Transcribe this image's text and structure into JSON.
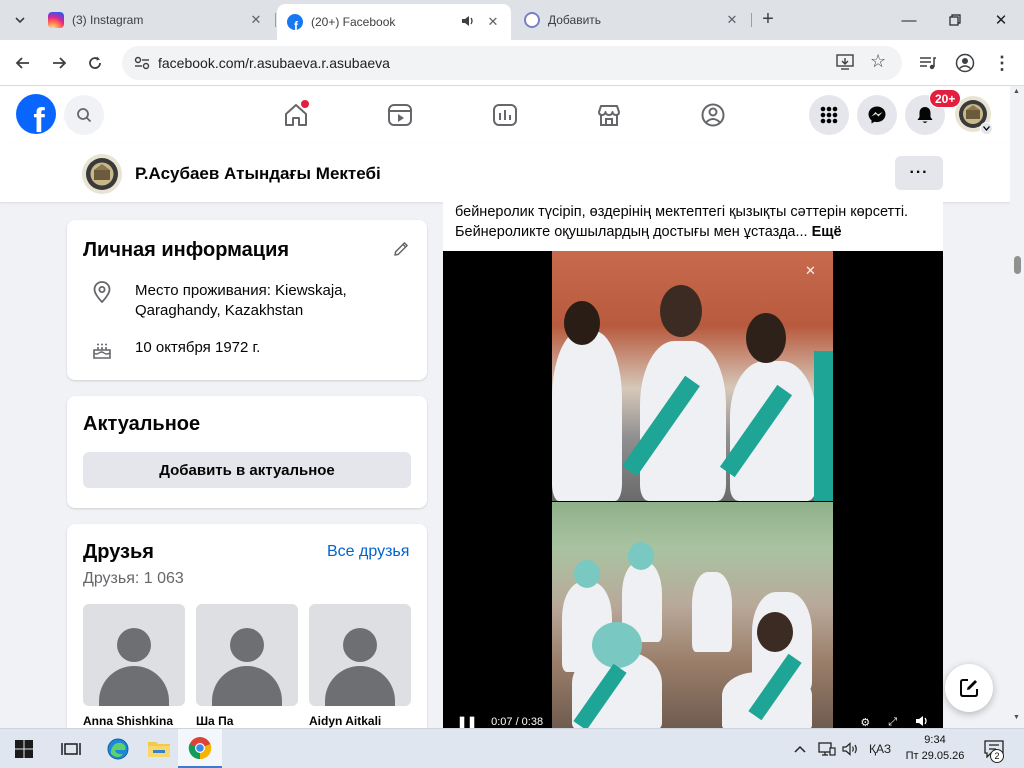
{
  "browser": {
    "tabs": [
      {
        "title": "(3) Instagram",
        "favicon": "instagram-icon"
      },
      {
        "title": "(20+) Facebook",
        "favicon": "facebook-icon",
        "active": true,
        "playing_audio": true
      },
      {
        "title": "Добавить",
        "favicon": "add-page-icon"
      }
    ],
    "address": "facebook.com/r.asubaeva.r.asubaeva"
  },
  "facebook": {
    "logo_letter": "f",
    "notifications_badge": "20+",
    "accent_color": "#0866ff"
  },
  "profile": {
    "name": "Р.Асубаев Атындағы Мектебі",
    "more_label": "···"
  },
  "intro": {
    "title": "Личная информация",
    "residence": "Место проживания: Kiewskaja, Qaraghandy, Kazakhstan",
    "birthday": "10 октября 1972 г."
  },
  "highlights": {
    "title": "Актуальное",
    "add_button": "Добавить в актуальное"
  },
  "friends": {
    "title": "Друзья",
    "see_all": "Все друзья",
    "count": "Друзья: 1 063",
    "list": [
      {
        "name": "Anna Shishkina"
      },
      {
        "name": "Ша Па"
      },
      {
        "name": "Aidyn Aitkali"
      }
    ]
  },
  "post": {
    "text": "бейнеролик түсіріп, өздерінің мектептегі қызықты сәттерін көрсетті. Бейнероликте оқушылардың достығы мен ұстазда...",
    "see_more": "Ещё",
    "video_time": "0:07 / 0:38"
  },
  "taskbar": {
    "language": "ҚАЗ",
    "time": "9:34",
    "date": "Пт 29.05.26",
    "notification_count": "2"
  }
}
